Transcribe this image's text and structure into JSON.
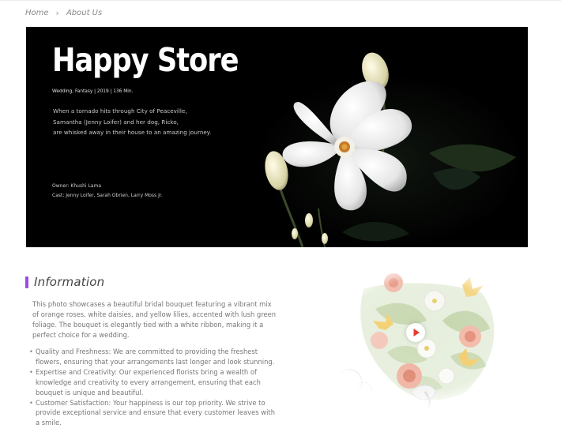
{
  "breadcrumb": {
    "home": "Home",
    "separator": "›",
    "current": "About Us"
  },
  "hero": {
    "title": "Happy Store",
    "meta": "Wedding, Fantasy  |  2019  |  136 Min.",
    "description_lines": [
      "When a tornado hits through City of Peaceville,",
      "Samantha (Jenny Loifer) and her dog, Ricko,",
      "are whisked away in their house to an amazing journey."
    ],
    "owner": "Owner: Khushi Lama",
    "cast": "Cast: Jenny Loifer, Sarah Obrien, Larry Moss Jr."
  },
  "info": {
    "title": "Information",
    "accent_color": "#9b4be8",
    "paragraph": "This photo showcases a beautiful bridal bouquet featuring a vibrant mix of orange roses, white daisies, and yellow lilies, accented with lush green foliage. The bouquet is elegantly tied with a white ribbon, making it a perfect choice for a wedding.",
    "features": [
      "Quality and Freshness: We are committed to providing the freshest flowers, ensuring that your arrangements last longer and look stunning.",
      "Expertise and Creativity: Our experienced florists bring a wealth of knowledge and creativity to every arrangement, ensuring that each bouquet is unique and beautiful.",
      "Customer Satisfaction: Your happiness is our top priority. We strive to provide exceptional service and ensure that every customer leaves with a smile."
    ]
  },
  "media": {
    "play_icon": "play-icon",
    "play_color": "#e63c2a"
  }
}
